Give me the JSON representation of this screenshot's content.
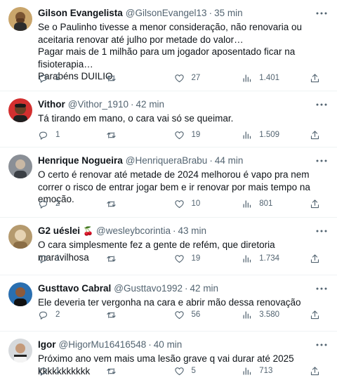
{
  "tweets": [
    {
      "name": "Gilson Evangelista",
      "handle": "@GilsonEvangel13",
      "time": "35 min",
      "text": "Se o Paulinho tivesse a menor consideração, não renovaria ou aceitaria renovar até julho por metade do valor…\nPagar mais de 1 milhão para um jogador aposentado ficar na fisioterapia…\nParabéns DUILIO",
      "replies": "2",
      "retweets": "",
      "likes": "27",
      "views": "1.401"
    },
    {
      "name": "Vithor",
      "handle": "@Vithor_1910",
      "time": "42 min",
      "text": "Tá tirando em mano, o cara vai só se queimar.",
      "replies": "1",
      "retweets": "",
      "likes": "19",
      "views": "1.509"
    },
    {
      "name": "Henrique Nogueira",
      "handle": "@HenriqueraBrabu",
      "time": "44 min",
      "text": "O certo é renovar até metade de 2024 melhorou é vapo pra nem correr o risco de entrar jogar bem e ir renovar por mais tempo na emoção.",
      "replies": "2",
      "retweets": "",
      "likes": "10",
      "views": "801"
    },
    {
      "name": "G2 uéslei",
      "name_emoji": "🍒",
      "handle": "@wesleybcorintia",
      "time": "43 min",
      "text": "O cara simplesmente fez a gente de refém, que diretoria maravilhosa",
      "replies": "1",
      "retweets": "",
      "likes": "19",
      "views": "1.734"
    },
    {
      "name": "Gusttavo Cabral",
      "handle": "@Gusttavo1992",
      "time": "42 min",
      "text": "Ele deveria ter vergonha na cara e abrir mão dessa renovação",
      "replies": "2",
      "retweets": "",
      "likes": "56",
      "views": "3.580"
    },
    {
      "name": "Igor",
      "handle": "@HigorMu16416548",
      "time": "40 min",
      "text": "Próximo ano vem mais uma lesão grave q vai durar até 2025 kkkkkkkkkkk",
      "replies": "1",
      "retweets": "",
      "likes": "5",
      "views": "713"
    }
  ],
  "separator": "·",
  "icons": {
    "reply": "reply-icon",
    "retweet": "retweet-icon",
    "like": "heart-icon",
    "views": "views-icon",
    "share": "share-icon",
    "more": "more-icon"
  },
  "colors": {
    "text": "#0f1419",
    "secondary": "#536471",
    "divider": "#eff3f4"
  }
}
